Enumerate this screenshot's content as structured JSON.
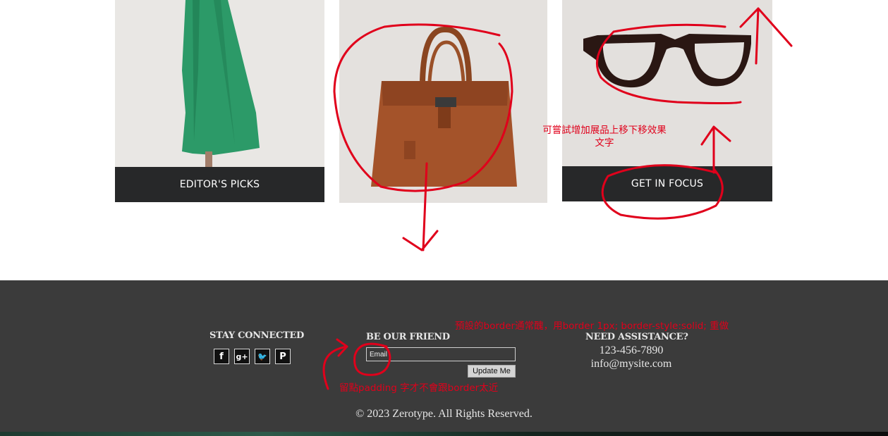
{
  "cards": {
    "editors_picks_label": "EDITOR'S PICKS",
    "get_in_focus_label": "GET IN FOCUS"
  },
  "footer": {
    "stay_connected": "STAY CONNECTED",
    "socials": [
      {
        "name": "facebook-icon",
        "glyph": "f"
      },
      {
        "name": "google-plus-icon",
        "glyph": "g+"
      },
      {
        "name": "twitter-icon",
        "glyph": "🐦"
      },
      {
        "name": "pinterest-icon",
        "glyph": "P"
      }
    ],
    "be_our_friend": "BE OUR FRIEND",
    "email_placeholder": "Email",
    "update_button": "Update Me",
    "need_assistance": "NEED ASSISTANCE?",
    "phone": "123-456-7890",
    "email": "info@mysite.com",
    "copyright": "© 2023 Zerotype. All Rights Reserved."
  },
  "annotations": {
    "note_1_line_1": "可嘗試增加展品上移下移效果",
    "note_1_line_2": "文字",
    "note_2": "預設的border通常醜，用border 1px; border-style:solid; 重做",
    "note_3": "留點padding 字才不會跟border太近"
  },
  "colors": {
    "footer_bg": "#3b3b3b",
    "card_bar": "#272829",
    "annotation_red": "#e0001b"
  }
}
